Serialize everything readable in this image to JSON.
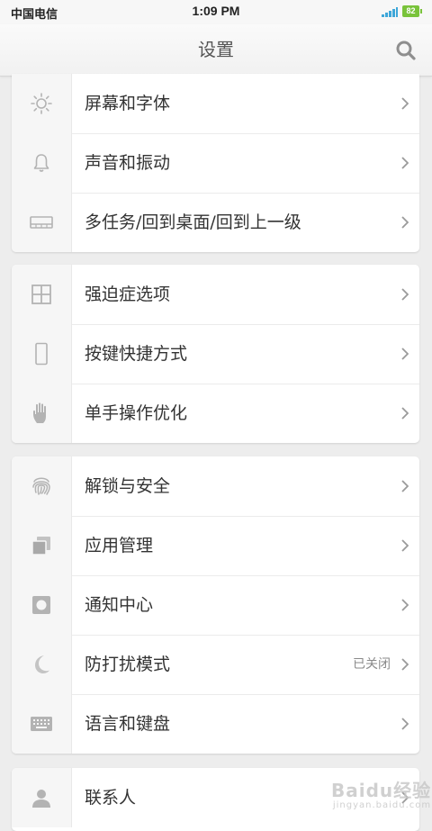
{
  "status_bar": {
    "carrier": "中国电信",
    "time": "1:09 PM",
    "battery": "82"
  },
  "header": {
    "title": "设置",
    "search_icon": "search-icon"
  },
  "groups": [
    {
      "items": [
        {
          "label": "屏幕和字体",
          "icon": "brightness-icon"
        },
        {
          "label": "声音和振动",
          "icon": "bell-icon"
        },
        {
          "label": "多任务/回到桌面/回到上一级",
          "icon": "keys-icon"
        }
      ]
    },
    {
      "items": [
        {
          "label": "强迫症选项",
          "icon": "grid-icon"
        },
        {
          "label": "按键快捷方式",
          "icon": "phone-icon"
        },
        {
          "label": "单手操作优化",
          "icon": "hand-icon"
        }
      ]
    },
    {
      "items": [
        {
          "label": "解锁与安全",
          "icon": "fingerprint-icon"
        },
        {
          "label": "应用管理",
          "icon": "apps-icon"
        },
        {
          "label": "通知中心",
          "icon": "notification-icon"
        },
        {
          "label": "防打扰模式",
          "icon": "moon-icon",
          "value": "已关闭"
        },
        {
          "label": "语言和键盘",
          "icon": "keyboard-icon"
        }
      ]
    },
    {
      "items": [
        {
          "label": "联系人",
          "icon": "person-icon"
        }
      ]
    }
  ],
  "watermark": {
    "text": "Baidu经验",
    "sub": "jingyan.baidu.com"
  },
  "colors": {
    "accent_signal": "#3ea7d9",
    "battery": "#79c33a",
    "icon_gray": "#b3b3b3"
  }
}
